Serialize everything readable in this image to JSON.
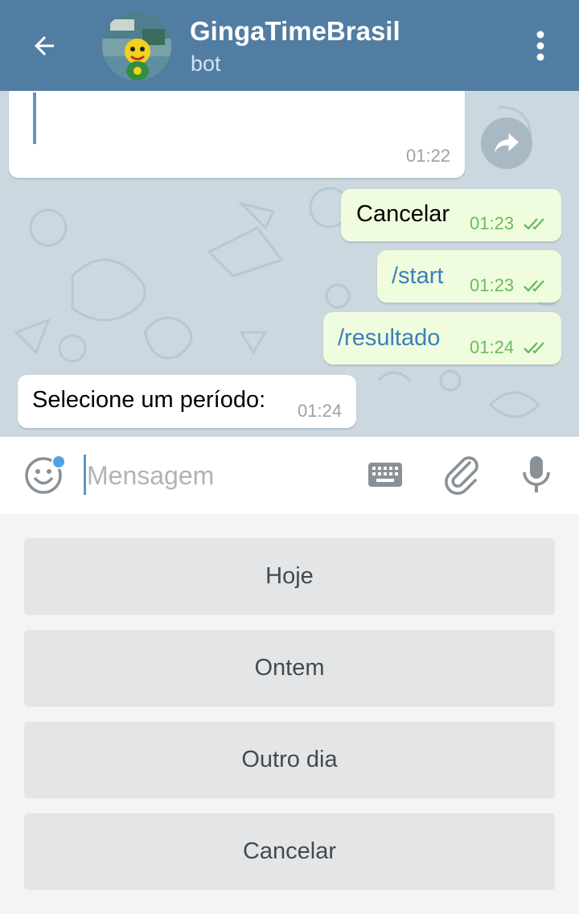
{
  "header": {
    "back_icon": "arrow-left-icon",
    "title": "GingaTimeBrasil",
    "subtitle": "bot",
    "menu_icon": "more-vertical-icon",
    "color": "#527da3"
  },
  "messages": [
    {
      "direction": "in",
      "text": "",
      "time": "01:22"
    },
    {
      "direction": "out",
      "text": "Cancelar",
      "time": "01:23",
      "status": "read"
    },
    {
      "direction": "out",
      "text": "/start",
      "time": "01:23",
      "status": "read"
    },
    {
      "direction": "out",
      "text": "/resultado",
      "time": "01:24",
      "status": "read"
    },
    {
      "direction": "in",
      "text": "Selecione um período:",
      "time": "01:24"
    }
  ],
  "composer": {
    "placeholder": "Mensagem",
    "emoji_icon": "emoji-icon",
    "keyboard_icon": "keyboard-icon",
    "attach_icon": "paperclip-icon",
    "mic_icon": "microphone-icon"
  },
  "reply_keyboard": {
    "buttons": [
      "Hoje",
      "Ontem",
      "Outro dia",
      "Cancelar"
    ]
  }
}
